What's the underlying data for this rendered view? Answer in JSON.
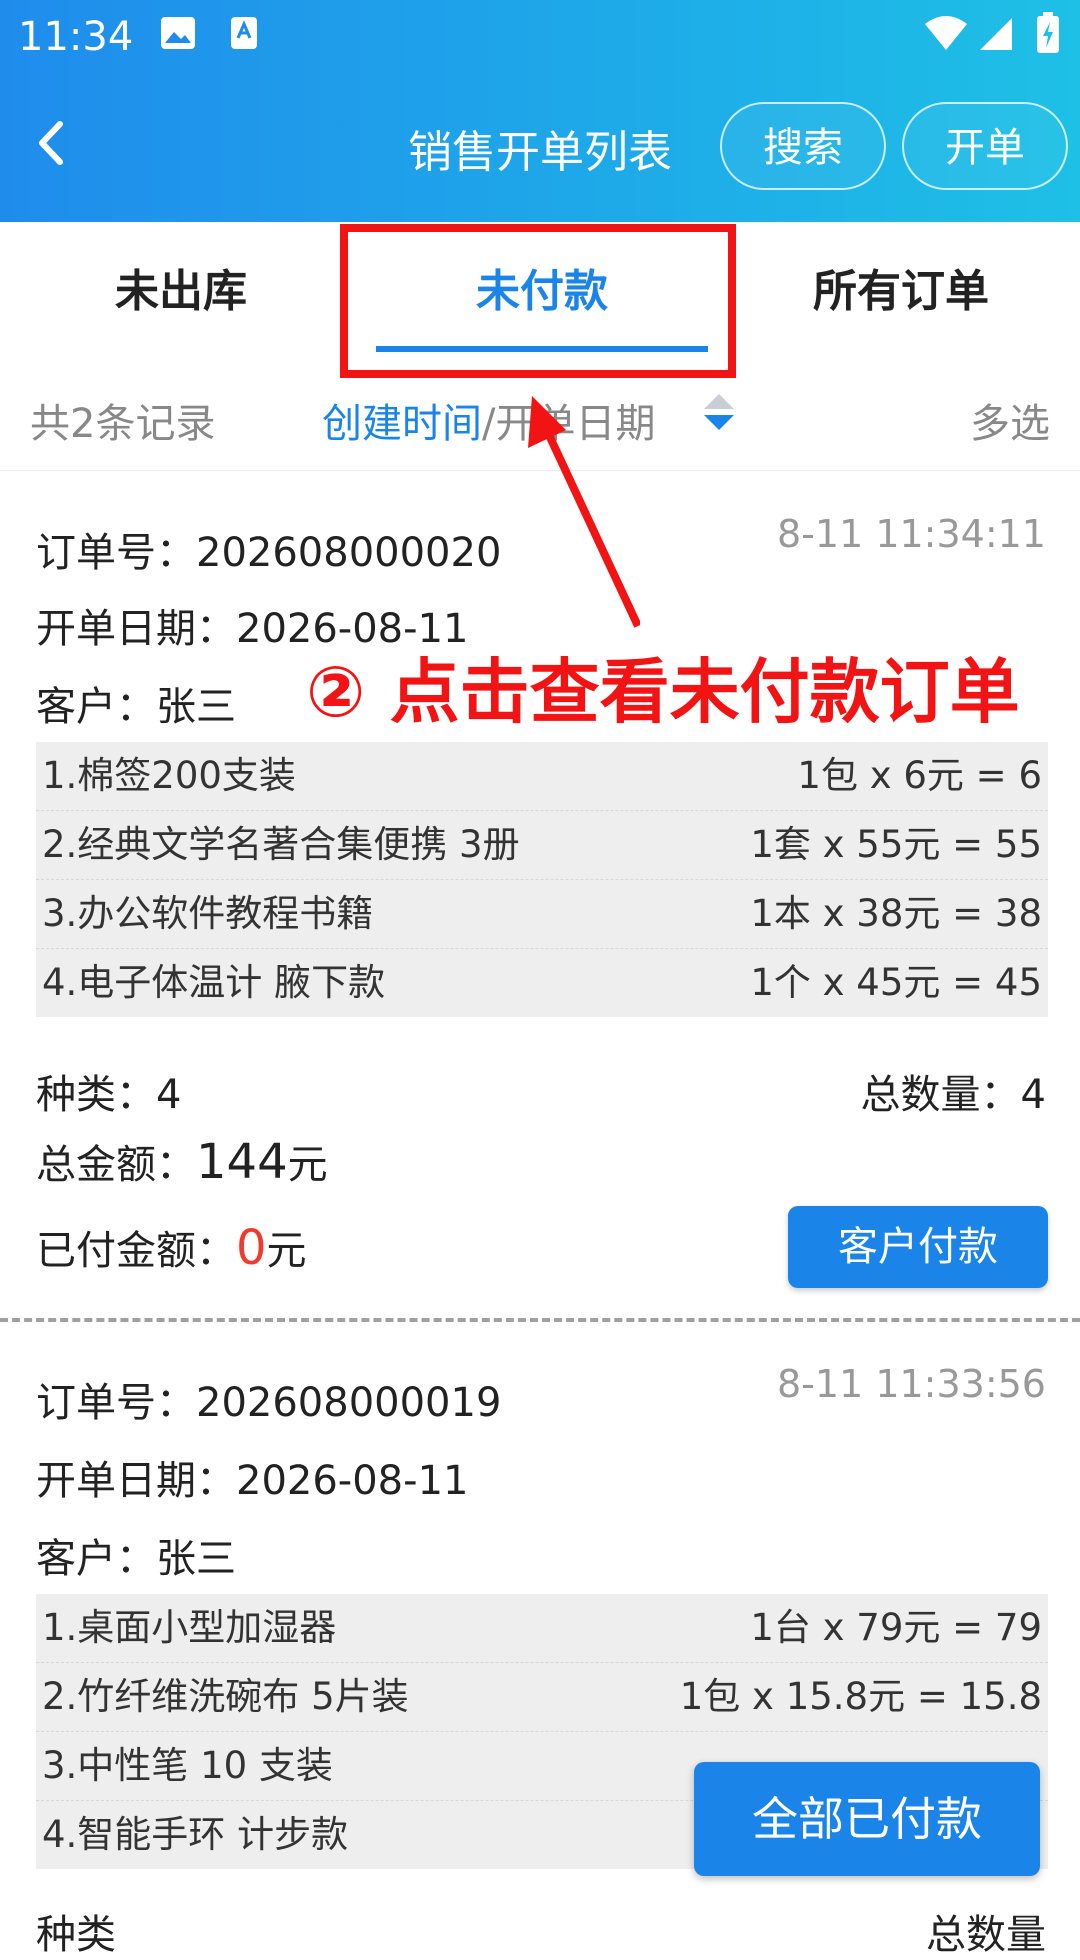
{
  "status_bar": {
    "time": "11:34"
  },
  "header": {
    "title": "销售开单列表",
    "search_label": "搜索",
    "create_label": "开单"
  },
  "tabs": [
    {
      "label": "未出库"
    },
    {
      "label": "未付款"
    },
    {
      "label": "所有订单"
    }
  ],
  "filter": {
    "count": "共2条记录",
    "sort_active": "创建时间",
    "sort_sep": "/",
    "sort_other": "开单日期",
    "multi": "多选"
  },
  "annotation": "② 点击查看未付款订单",
  "orders": [
    {
      "order_no_label": "订单号：",
      "order_no": "202608000020",
      "time": "8-11 11:34:11",
      "date_label": "开单日期：",
      "date": "2026-08-11",
      "customer_label": "客户：",
      "customer": "张三",
      "items": [
        {
          "name": "1.棉签200支装",
          "price": "1包 x 6元 = 6"
        },
        {
          "name": "2.经典文学名著合集便携 3册",
          "price": "1套 x 55元 = 55"
        },
        {
          "name": "3.办公软件教程书籍",
          "price": "1本 x 38元 = 38"
        },
        {
          "name": "4.电子体温计 腋下款",
          "price": "1个 x 45元 = 45"
        }
      ],
      "kinds_label": "种类：",
      "kinds": "4",
      "qty_label": "总数量：",
      "qty": "4",
      "total_label": "总金额：",
      "total": "144",
      "total_unit": "元",
      "paid_label": "已付金额：",
      "paid": "0",
      "paid_unit": "元",
      "pay_button": "客户付款"
    },
    {
      "order_no_label": "订单号：",
      "order_no": "202608000019",
      "time": "8-11 11:33:56",
      "date_label": "开单日期：",
      "date": "2026-08-11",
      "customer_label": "客户：",
      "customer": "张三",
      "items": [
        {
          "name": "1.桌面小型加湿器",
          "price": "1台 x 79元 = 79"
        },
        {
          "name": "2.竹纤维洗碗布 5片装",
          "price": "1包 x 15.8元 = 15.8"
        },
        {
          "name": "3.中性笔 10 支装",
          "price": ""
        },
        {
          "name": "4.智能手环 计步款",
          "price": ""
        }
      ],
      "kinds_label": "种类",
      "qty_label": "总数量"
    }
  ],
  "all_paid_button": "全部已付款"
}
